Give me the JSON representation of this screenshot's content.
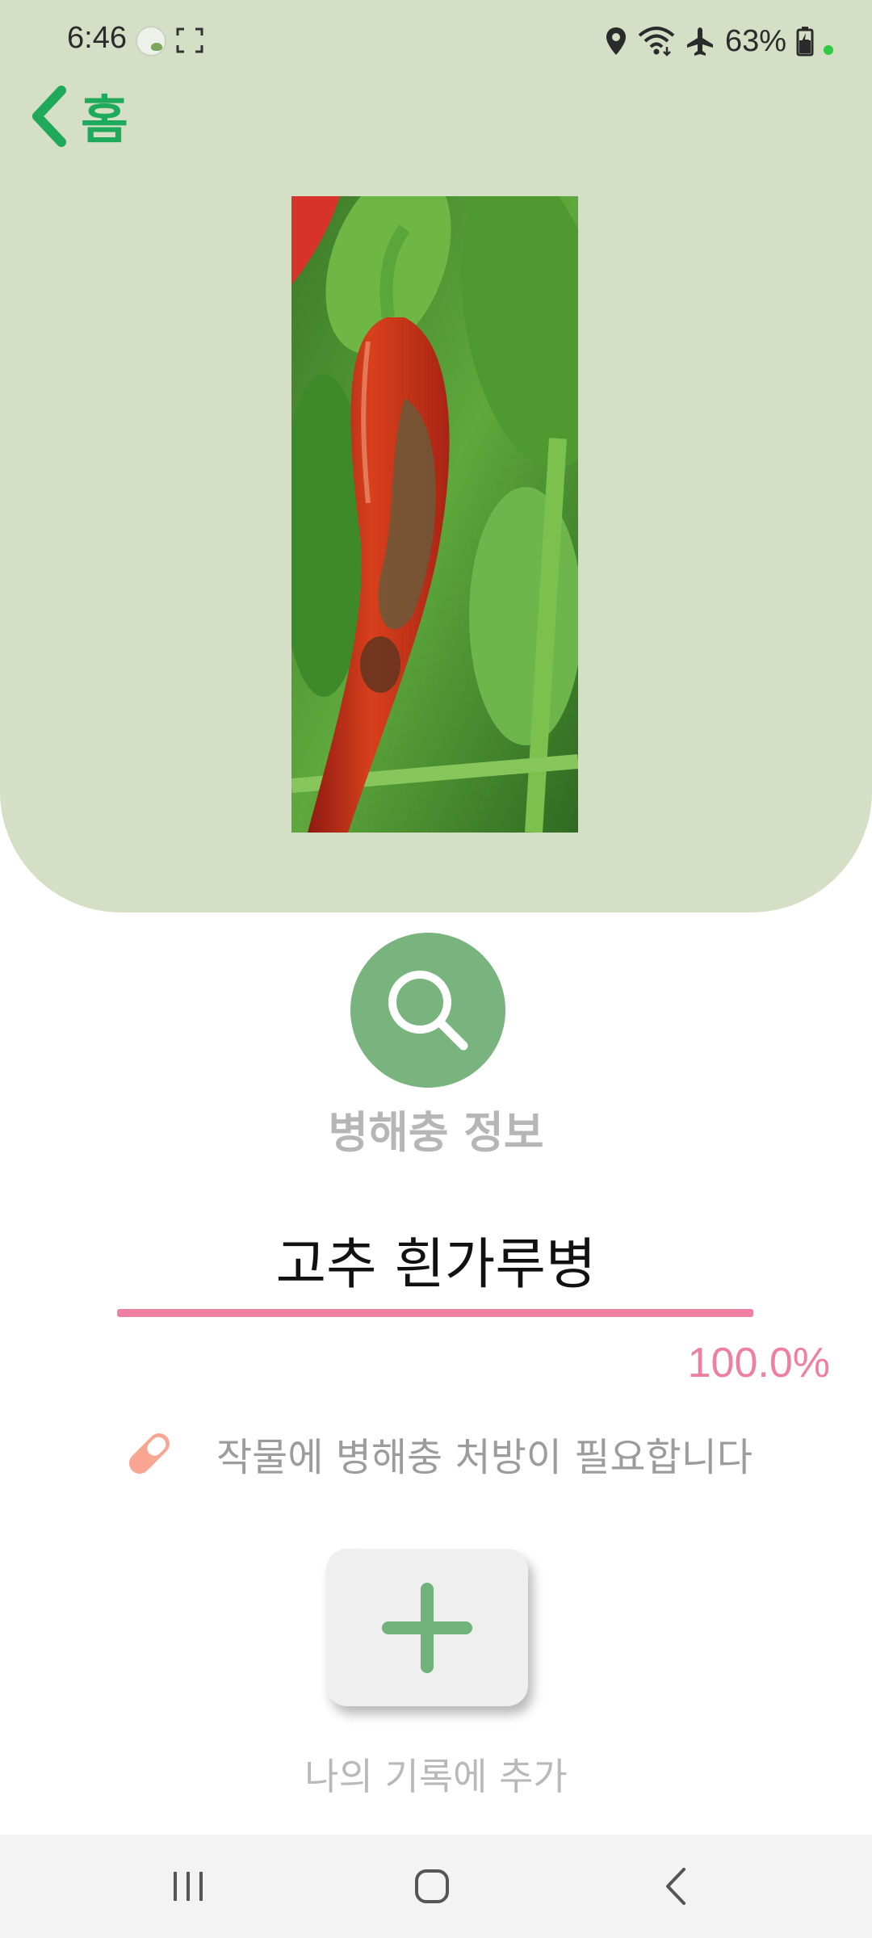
{
  "status_bar": {
    "time": "6:46",
    "battery_percent": "63%",
    "icons": [
      "app-notification-icon",
      "screenshot-icon",
      "location-icon",
      "wifi-icon",
      "airplane-mode-icon",
      "battery-charging-icon",
      "mic-active-dot"
    ]
  },
  "header": {
    "back_label": "홈",
    "accent_color": "#1fa95a",
    "background_color": "#d5dfc6"
  },
  "result": {
    "info_label": "병해충 정보",
    "disease_name": "고추 흰가루병",
    "confidence_text": "100.0%",
    "confidence_value": 1.0,
    "notice_text": "작물에 병해충 처방이 필요합니다",
    "bar_color": "#f07fa4"
  },
  "actions": {
    "add_label": "나의 기록에 추가"
  },
  "nav": {
    "items": [
      "recent-apps-icon",
      "home-icon",
      "back-icon"
    ]
  }
}
